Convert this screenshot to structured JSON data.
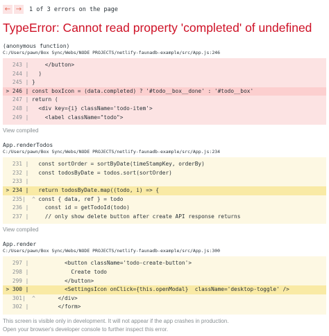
{
  "nav": {
    "prev_icon": "left-arrow",
    "next_icon": "right-arrow",
    "prev_glyph": "←",
    "next_glyph": "→",
    "count_text": "1 of 3 errors on the page"
  },
  "error": {
    "title": "TypeError: Cannot read property 'completed' of undefined"
  },
  "frames": [
    {
      "name": "(anonymous function)",
      "file": "C:/Users/pawn/Box Sync/Webs/NODE PROJECTS/netlify-faunadb-example/src/App.js:246",
      "lines": [
        {
          "num": "243",
          "gutter": "|",
          "code": "    </button>"
        },
        {
          "num": "244",
          "gutter": "|",
          "code": "  )"
        },
        {
          "num": "245",
          "gutter": "|",
          "code": "}"
        },
        {
          "num": "> 246",
          "gutter": "|",
          "code": "const boxIcon = (data.completed) ? '#todo__box__done' : '#todo__box'"
        },
        {
          "num": "247",
          "gutter": "|",
          "code": "return ("
        },
        {
          "num": "248",
          "gutter": "|",
          "code": "  <div key={i} className='todo-item'>"
        },
        {
          "num": "249",
          "gutter": "|",
          "code": "    <label className=\"todo\">"
        }
      ],
      "view_compiled": "View compiled"
    },
    {
      "name": "App.renderTodos",
      "file": "C:/Users/pawn/Box Sync/Webs/NODE PROJECTS/netlify-faunadb-example/src/App.js:234",
      "lines": [
        {
          "num": "231",
          "gutter": "|",
          "code": "  const sortOrder = sortByDate(timeStampKey, orderBy)"
        },
        {
          "num": "232",
          "gutter": "|",
          "code": "  const todosByDate = todos.sort(sortOrder)"
        },
        {
          "num": "233",
          "gutter": "|",
          "code": ""
        },
        {
          "num": "> 234",
          "gutter": "|",
          "code": "  return todosByDate.map((todo, i) => {"
        },
        {
          "num": "235",
          "gutter": "|  ^",
          "code": "  const { data, ref } = todo"
        },
        {
          "num": "236",
          "gutter": "|",
          "code": "    const id = getTodoId(todo)"
        },
        {
          "num": "237",
          "gutter": "|",
          "code": "    // only show delete button after create API response returns"
        }
      ],
      "view_compiled": "View compiled"
    },
    {
      "name": "App.render",
      "file": "C:/Users/pawn/Box Sync/Webs/NODE PROJECTS/netlify-faunadb-example/src/App.js:300",
      "lines": [
        {
          "num": "297",
          "gutter": "|",
          "code": "          <button className='todo-create-button'>"
        },
        {
          "num": "298",
          "gutter": "|",
          "code": "            Create todo"
        },
        {
          "num": "299",
          "gutter": "|",
          "code": "          </button>"
        },
        {
          "num": "> 300",
          "gutter": "|",
          "code": "          <SettingsIcon onClick={this.openModal}  className='desktop-toggle' />"
        },
        {
          "num": "301",
          "gutter": "|  ^",
          "code": "        </div>"
        },
        {
          "num": "302",
          "gutter": "|",
          "code": "        </form>"
        }
      ]
    }
  ],
  "footer": {
    "line1": "This screen is visible only in development. It will not appear if the app crashes in production.",
    "line2": "Open your browser's developer console to further inspect this error."
  },
  "colors": {
    "error_red": "#ce1126",
    "red_block": "#fce3e3",
    "red_highlight": "#fccfcf",
    "yellow_block": "#fdf8e3",
    "yellow_highlight": "#f9eaa5"
  }
}
